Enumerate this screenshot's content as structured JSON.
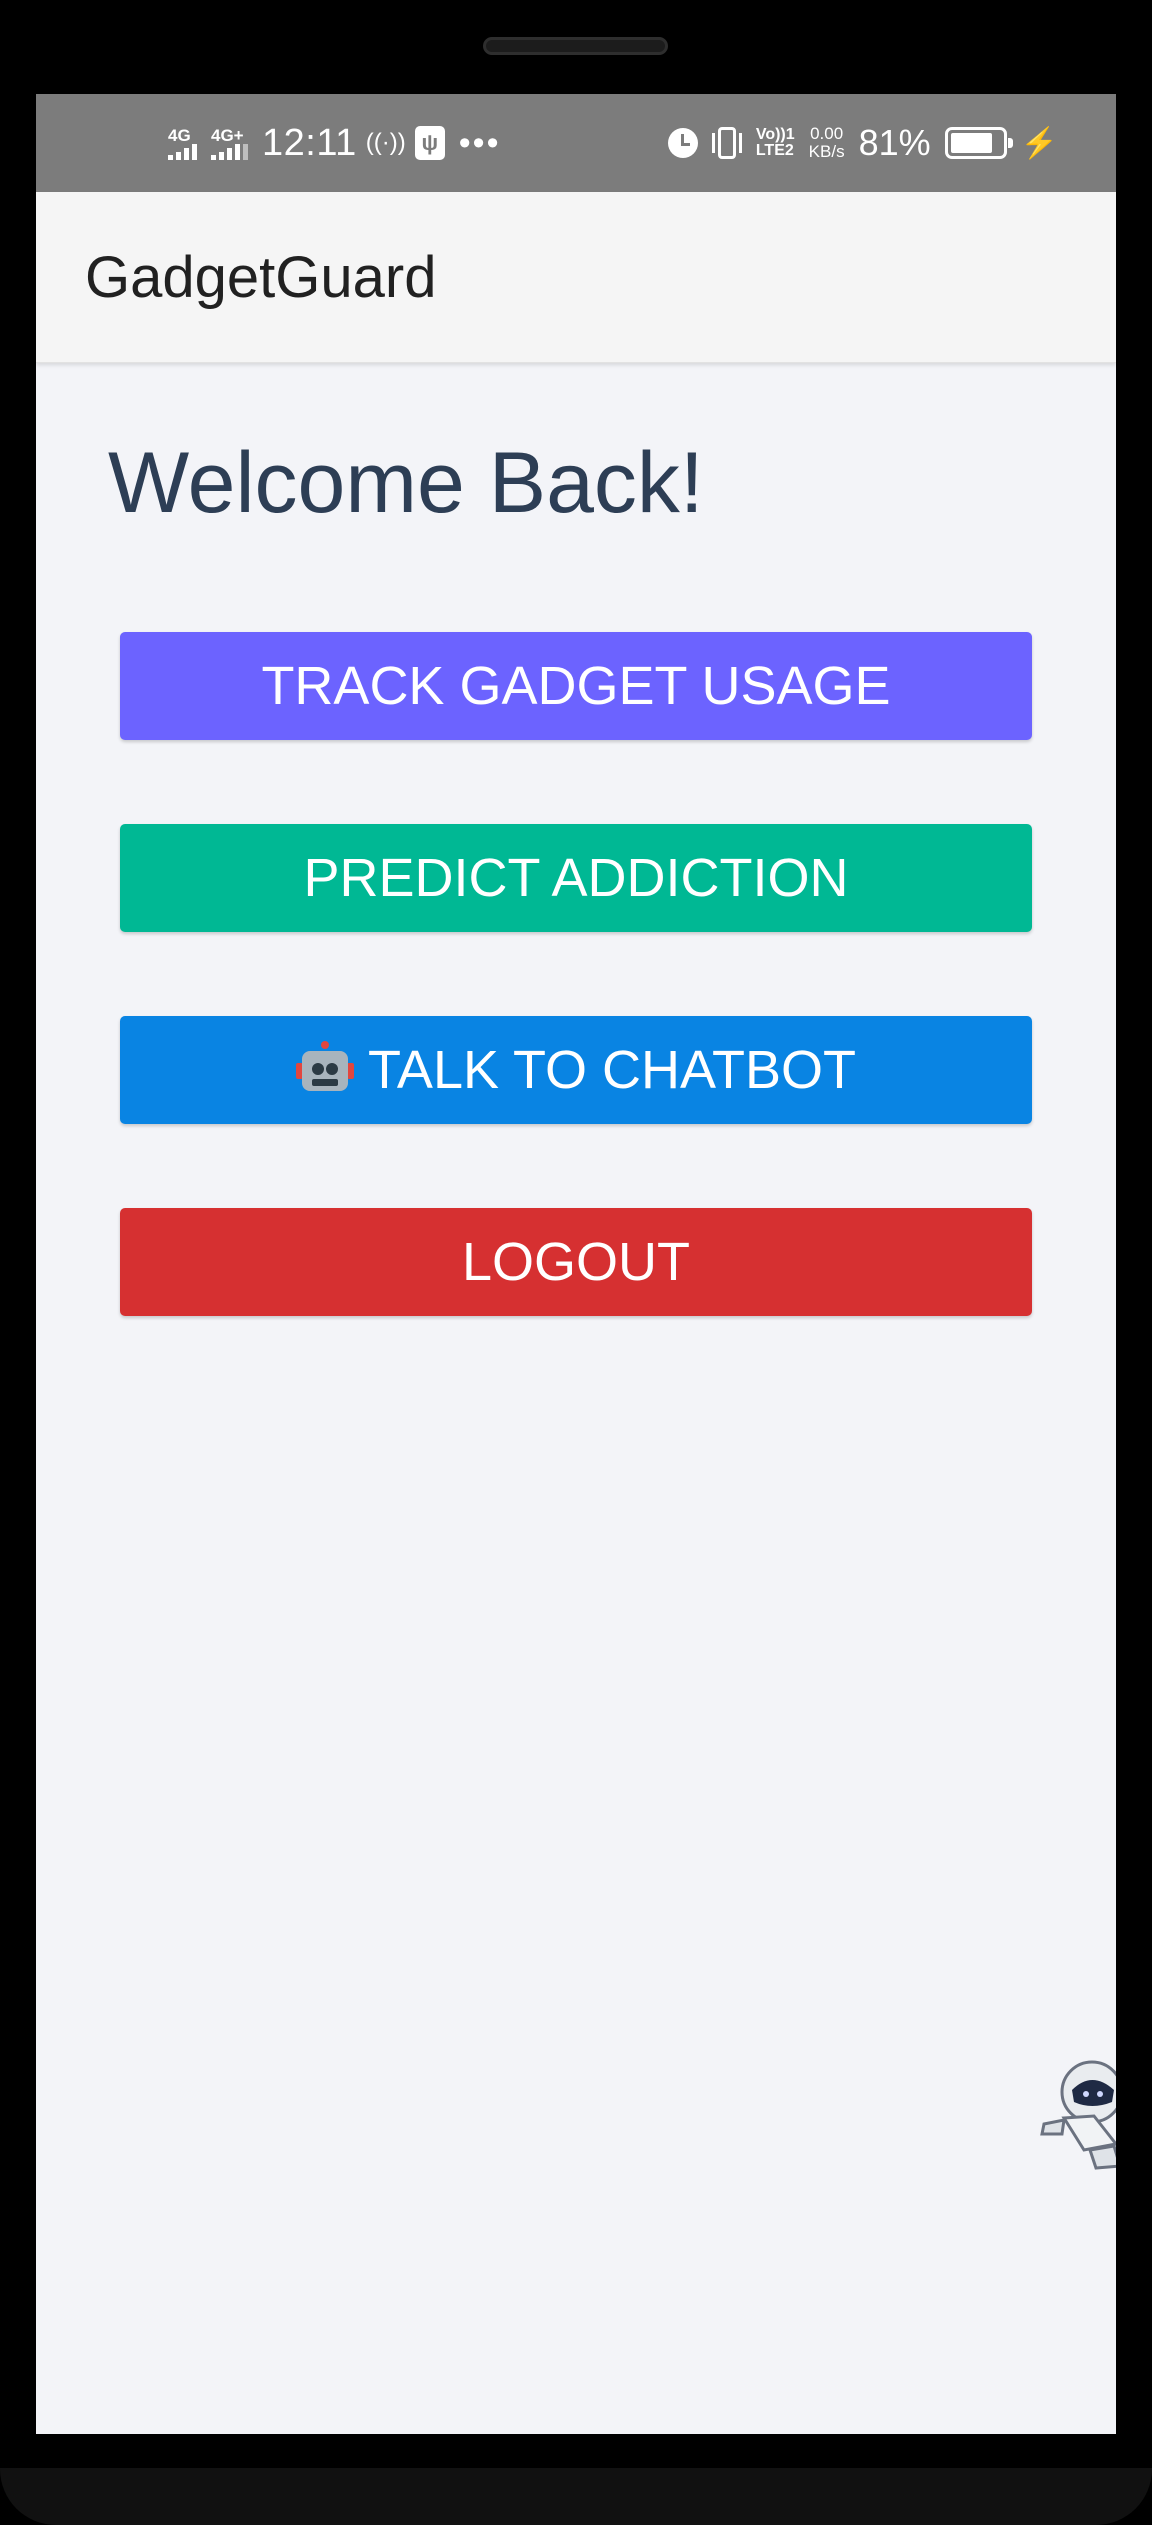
{
  "status_bar": {
    "network_1": "4G",
    "network_2": "4G+",
    "time": "12:11",
    "volte": "Vo))",
    "lte": "LTE2",
    "sim_index": "1",
    "speed_value": "0.00",
    "speed_unit": "KB/s",
    "battery_percent": "81%",
    "battery_level": 0.81,
    "overflow": "•••"
  },
  "app_bar": {
    "title": "GadgetGuard"
  },
  "main": {
    "heading": "Welcome Back!",
    "buttons": [
      {
        "label": "TRACK GADGET USAGE",
        "color": "#6c63ff"
      },
      {
        "label": "PREDICT ADDICTION",
        "color": "#00b894"
      },
      {
        "label": "TALK TO CHATBOT",
        "icon": "robot-icon",
        "color": "#0984e3"
      },
      {
        "label": "LOGOUT",
        "color": "#d63031"
      }
    ]
  },
  "colors": {
    "status_bar_bg": "#7c7c7c",
    "app_bar_bg": "#f5f5f5",
    "screen_bg": "#f3f4f8",
    "heading_text": "#2d3e55"
  }
}
